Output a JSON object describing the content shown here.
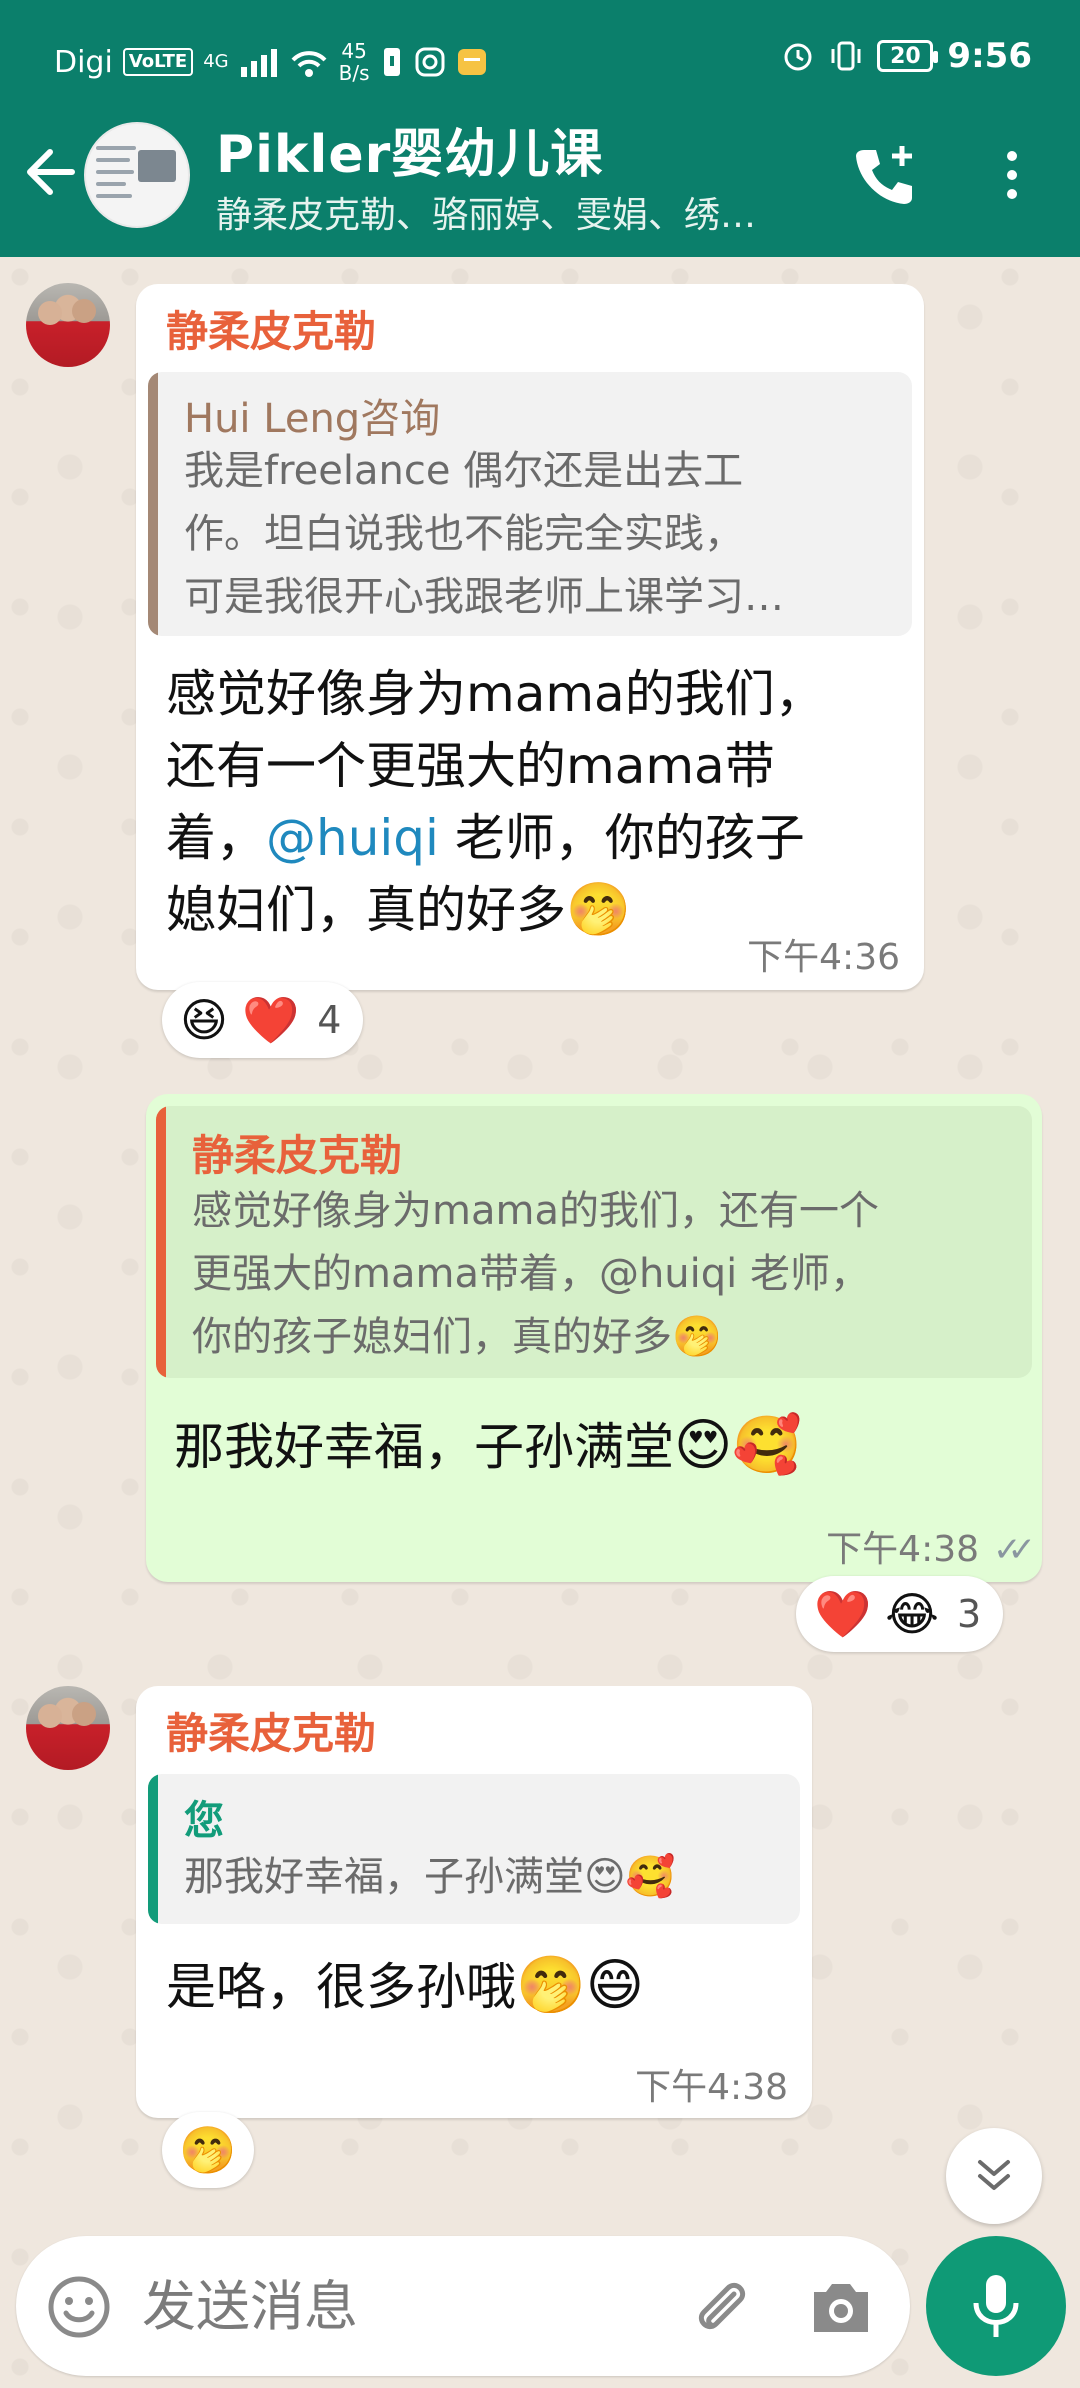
{
  "status_bar": {
    "carrier": "Digi",
    "volte": "VoLTE",
    "network": "4G",
    "speed_value": "45",
    "speed_unit": "B/s",
    "battery": "20",
    "time": "9:56"
  },
  "header": {
    "title": "Pikler婴幼儿课",
    "subtitle": "静柔皮克勒、骆丽婷、雯娟、绣…"
  },
  "messages": [
    {
      "sender": "静柔皮克勒",
      "quote_sender": "Hui Leng咨询",
      "quote_lines": [
        "我是freelance 偶尔还是出去工",
        "作。坦白说我也不能完全实践，",
        "可是我很开心我跟老师上课学习…"
      ],
      "text_lines": [
        "感觉好像身为mama的我们，",
        "还有一个更强大的mama带",
        "着，",
        "老师，你的孩子",
        "媳妇们，真的好多"
      ],
      "mention": "@huiqi",
      "time": "下午4:36",
      "reaction_count": "4"
    },
    {
      "quote_sender": "静柔皮克勒",
      "quote_lines": [
        "感觉好像身为mama的我们，还有一个",
        "更强大的mama带着，@huiqi 老师，",
        "你的孩子媳妇们，真的好多"
      ],
      "text": "那我好幸福，子孙满堂",
      "time": "下午4:38",
      "reaction_count": "3"
    },
    {
      "sender": "静柔皮克勒",
      "quote_sender": "您",
      "quote_text": "那我好幸福，子孙满堂",
      "text": "是咯，很多孙哦",
      "time": "下午4:38"
    }
  ],
  "composer": {
    "placeholder": "发送消息"
  },
  "colors": {
    "header_bg": "#0B7F6B",
    "sender_name": "#E8613B",
    "mention": "#1F89BE",
    "outgoing_bubble": "#E2FDD6",
    "mic_button": "#0F9A76"
  },
  "icons": [
    "back-arrow-icon",
    "add-call-icon",
    "more-vert-icon",
    "emoji-icon",
    "attach-icon",
    "camera-icon",
    "mic-icon",
    "double-chevron-down-icon",
    "read-ticks-icon"
  ]
}
